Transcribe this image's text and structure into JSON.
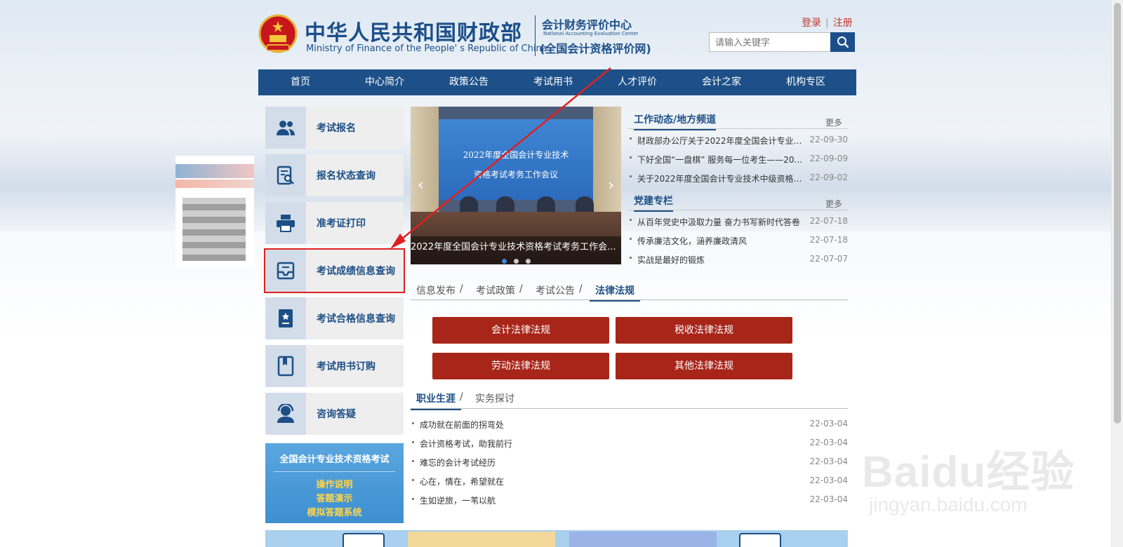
{
  "header": {
    "title_cn": "中华人民共和国财政部",
    "title_en": "Ministry of Finance of the People' s Republic of China",
    "sub_cn": "会计财务评价中心",
    "sub_en": "National Accounting Evaluation Center",
    "sub_cn2": "(全国会计资格评价网)",
    "login": "登录",
    "register": "注册",
    "search_placeholder": "请输入关键字"
  },
  "nav": [
    "首页",
    "中心简介",
    "政策公告",
    "考试用书",
    "人才评价",
    "会计之家",
    "机构专区"
  ],
  "sidebar": [
    {
      "label": "考试报名",
      "icon": "users-icon"
    },
    {
      "label": "报名状态查询",
      "icon": "document-search-icon"
    },
    {
      "label": "准考证打印",
      "icon": "printer-icon"
    },
    {
      "label": "考试成绩信息查询",
      "icon": "inbox-icon"
    },
    {
      "label": "考试合格信息查询",
      "icon": "certificate-icon"
    },
    {
      "label": "考试用书订购",
      "icon": "book-icon"
    },
    {
      "label": "咨询答疑",
      "icon": "support-agent-icon"
    }
  ],
  "exam_box": {
    "title": "全国会计专业技术资格考试",
    "links": [
      "操作说明",
      "答题演示",
      "模拟答题系统"
    ]
  },
  "carousel": {
    "screen_line1": "2022年度全国会计专业技术",
    "screen_line2": "资格考试考务工作会议",
    "caption": "2022年度全国会计专业技术资格考试考务工作会..."
  },
  "news1": {
    "title": "工作动态/地方频道",
    "more": "更多",
    "items": [
      {
        "text": "财政部办公厅关于2022年度全国会计专业技...",
        "date": "22-09-30"
      },
      {
        "text": "下好全国“一盘棋” 服务每一位考生——20...",
        "date": "22-09-09"
      },
      {
        "text": "关于2022年度全国会计专业技术中级资格考...",
        "date": "22-09-02"
      }
    ]
  },
  "news2": {
    "title": "党建专栏",
    "more": "更多",
    "items": [
      {
        "text": "从百年党史中汲取力量 奋力书写新时代答卷",
        "date": "22-07-18"
      },
      {
        "text": "传承廉洁文化，涵养廉政清风",
        "date": "22-07-18"
      },
      {
        "text": "实战是最好的锻炼",
        "date": "22-07-07"
      }
    ]
  },
  "tabs1": [
    "信息发布",
    "考试政策",
    "考试公告",
    "法律法规"
  ],
  "law_buttons": [
    "会计法律法规",
    "税收法律法规",
    "劳动法律法规",
    "其他法律法规"
  ],
  "tabs2": [
    "职业生涯",
    "实务探讨"
  ],
  "career": [
    {
      "text": "成功就在前面的拐弯处",
      "date": "22-03-04"
    },
    {
      "text": "会计资格考试，助我前行",
      "date": "22-03-04"
    },
    {
      "text": "难忘的会计考试经历",
      "date": "22-03-04"
    },
    {
      "text": "心在，情在，希望就在",
      "date": "22-03-04"
    },
    {
      "text": "生如逆旅，一苇以航",
      "date": "22-03-04"
    }
  ],
  "watermark": {
    "line1": "Baidu经验",
    "line2": "jingyan.baidu.com"
  },
  "colors": {
    "brand": "#1d5088",
    "law_button": "#a8251a",
    "annotation": "#e02020"
  }
}
